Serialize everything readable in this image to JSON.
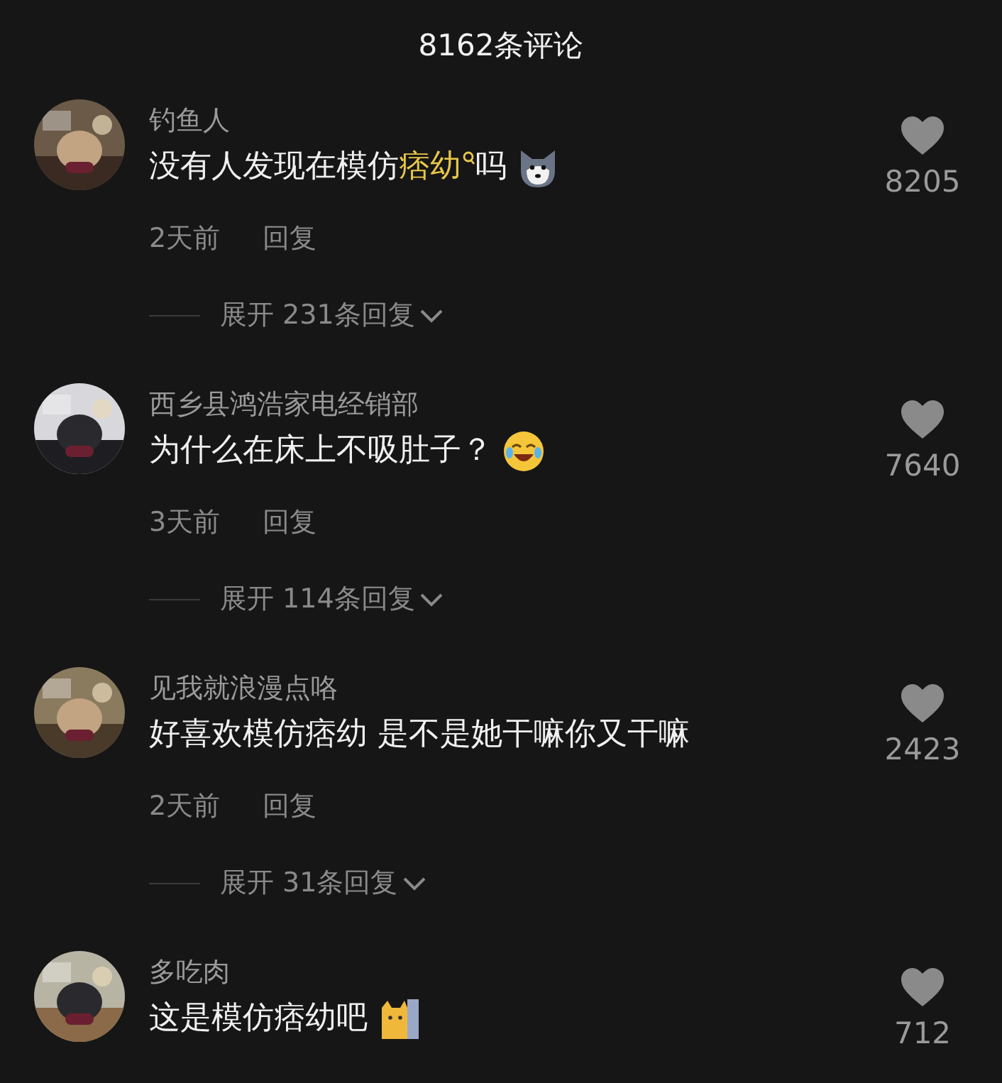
{
  "title": "8162条评论",
  "comments": [
    {
      "name": "钓鱼人",
      "text": [
        {
          "kind": "plain",
          "text": "没有人发现在模仿"
        },
        {
          "kind": "search_link",
          "text": "痞幼"
        },
        {
          "kind": "plain",
          "text": "吗"
        },
        {
          "kind": "emoji_husky"
        }
      ],
      "likes": "8205",
      "time": "2天前",
      "reply": "回复",
      "expand": "展开 231条回复"
    },
    {
      "name": "西乡县鸿浩家电经销部",
      "text": [
        {
          "kind": "plain",
          "text": "为什么在床上不吸肚子？"
        },
        {
          "kind": "emoji_laugh"
        }
      ],
      "likes": "7640",
      "time": "3天前",
      "reply": "回复",
      "expand": "展开 114条回复"
    },
    {
      "name": "见我就浪漫点咯",
      "text": [
        {
          "kind": "plain",
          "text": "好喜欢模仿痞幼 是不是她干嘛你又干嘛"
        }
      ],
      "likes": "2423",
      "time": "2天前",
      "reply": "回复",
      "expand": "展开 31条回复"
    },
    {
      "name": "多吃肉",
      "text": [
        {
          "kind": "plain",
          "text": "这是模仿痞幼吧"
        },
        {
          "kind": "emoji_cat"
        }
      ],
      "likes": "712"
    }
  ]
}
